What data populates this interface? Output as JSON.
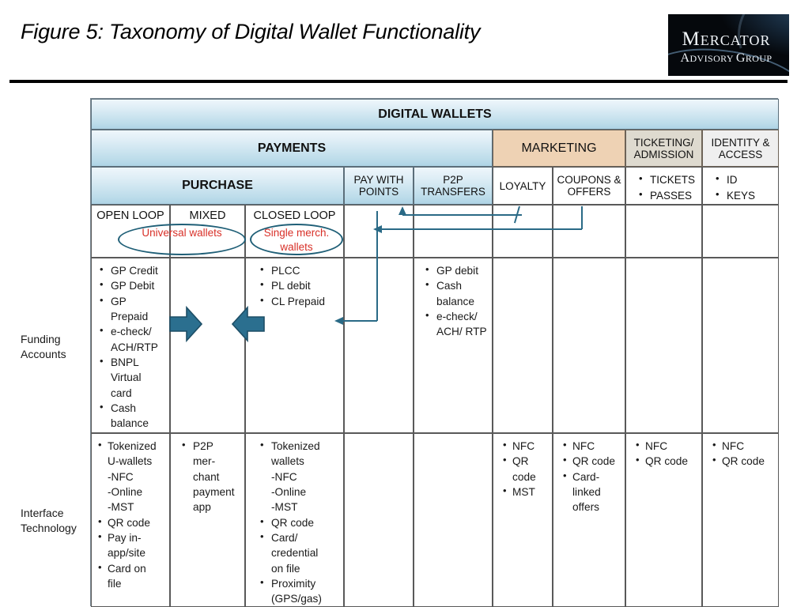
{
  "figure": {
    "title": "Figure 5: Taxonomy of Digital Wallet Functionality"
  },
  "logo": {
    "line1_first": "M",
    "line1_rest": "ERCATOR",
    "line2_a1": "A",
    "line2_a2": "DVISORY ",
    "line2_b1": "G",
    "line2_b2": "ROUP"
  },
  "table": {
    "top_header": "DIGITAL WALLETS",
    "level2": {
      "payments": "PAYMENTS",
      "marketing": "MARKETING",
      "ticketing": "TICKETING/ ADMISSION",
      "identity": "IDENTITY & ACCESS"
    },
    "level3": {
      "purchase": "PURCHASE",
      "pay_with_points": "PAY WITH POINTS",
      "p2p_transfers": "P2P TRANSFERS",
      "loyalty": "LOYALTY",
      "coupons": "COUPONS & OFFERS",
      "tickets_items": [
        "TICKETS",
        "PASSES"
      ],
      "identity_items": [
        "ID",
        "KEYS"
      ]
    },
    "level4": {
      "open_loop": "OPEN LOOP",
      "mixed": "MIXED",
      "closed_loop": "CLOSED LOOP"
    },
    "annotations": {
      "universal_wallets": "Universal wallets",
      "single_merchant_wallets": "Single merch. wallets"
    },
    "row_labels": {
      "funding_accounts": "Funding Accounts",
      "interface_technology": "Interface Technology"
    },
    "funding_accounts": {
      "open_loop": [
        {
          "text": "GP Credit",
          "bullet": true
        },
        {
          "text": "GP Debit",
          "bullet": true
        },
        {
          "text": "GP",
          "bullet": true
        },
        {
          "text": "Prepaid",
          "bullet": false
        },
        {
          "text": "e-check/",
          "bullet": true
        },
        {
          "text": "ACH/RTP",
          "bullet": false
        },
        {
          "text": "BNPL",
          "bullet": true
        },
        {
          "text": "Virtual",
          "bullet": false
        },
        {
          "text": "card",
          "bullet": false
        },
        {
          "text": "Cash",
          "bullet": true
        },
        {
          "text": "balance",
          "bullet": false
        }
      ],
      "mixed": [],
      "closed_loop": [
        {
          "text": "PLCC",
          "bullet": true
        },
        {
          "text": "PL debit",
          "bullet": true
        },
        {
          "text": "CL Prepaid",
          "bullet": true
        }
      ],
      "pay_with_points": [],
      "p2p_transfers": [
        {
          "text": "GP debit",
          "bullet": true
        },
        {
          "text": "Cash",
          "bullet": true
        },
        {
          "text": "balance",
          "bullet": false
        },
        {
          "text": "e-check/",
          "bullet": true
        },
        {
          "text": "ACH/ RTP",
          "bullet": false
        }
      ],
      "loyalty": [],
      "coupons": [],
      "ticketing": [],
      "identity": []
    },
    "interface_technology": {
      "open_loop": [
        {
          "text": "Tokenized",
          "bullet": true
        },
        {
          "text": "U-wallets",
          "bullet": false
        },
        {
          "text": "-NFC",
          "bullet": false
        },
        {
          "text": "-Online",
          "bullet": false
        },
        {
          "text": "-MST",
          "bullet": false
        },
        {
          "text": "QR code",
          "bullet": true
        },
        {
          "text": "Pay in-",
          "bullet": true
        },
        {
          "text": "app/site",
          "bullet": false
        },
        {
          "text": "Card on",
          "bullet": true
        },
        {
          "text": "file",
          "bullet": false
        }
      ],
      "mixed": [
        {
          "text": "P2P",
          "bullet": true
        },
        {
          "text": "mer-",
          "bullet": false
        },
        {
          "text": "chant",
          "bullet": false
        },
        {
          "text": "payment",
          "bullet": false
        },
        {
          "text": "app",
          "bullet": false
        }
      ],
      "closed_loop": [
        {
          "text": "Tokenized",
          "bullet": true
        },
        {
          "text": "wallets",
          "bullet": false
        },
        {
          "text": "-NFC",
          "bullet": false
        },
        {
          "text": "-Online",
          "bullet": false
        },
        {
          "text": "-MST",
          "bullet": false
        },
        {
          "text": "QR code",
          "bullet": true
        },
        {
          "text": "Card/",
          "bullet": true
        },
        {
          "text": "credential",
          "bullet": false
        },
        {
          "text": "on file",
          "bullet": false
        },
        {
          "text": "Proximity",
          "bullet": true
        },
        {
          "text": "(GPS/gas)",
          "bullet": false
        }
      ],
      "pay_with_points": [],
      "p2p_transfers": [],
      "loyalty": [
        {
          "text": "NFC",
          "bullet": true
        },
        {
          "text": "QR",
          "bullet": true
        },
        {
          "text": "code",
          "bullet": false
        },
        {
          "text": "MST",
          "bullet": true
        }
      ],
      "coupons": [
        {
          "text": "NFC",
          "bullet": true
        },
        {
          "text": "QR code",
          "bullet": true
        },
        {
          "text": "Card-",
          "bullet": true
        },
        {
          "text": "linked",
          "bullet": false
        },
        {
          "text": "offers",
          "bullet": false
        }
      ],
      "ticketing": [
        {
          "text": "NFC",
          "bullet": true
        },
        {
          "text": "QR code",
          "bullet": true
        }
      ],
      "identity": [
        {
          "text": "NFC",
          "bullet": true
        },
        {
          "text": "QR code",
          "bullet": true
        }
      ]
    },
    "colors": {
      "header_blue_top": "#eef6fb",
      "header_blue_bottom": "#aed3e5",
      "marketing_peach": "#eed2b4",
      "ticketing_tan": "#dedacf",
      "identity_grey": "#efefef",
      "annotation_red": "#d83028",
      "connector_teal": "#2a6a86",
      "block_arrow_blue": "#2b6f8f"
    }
  }
}
